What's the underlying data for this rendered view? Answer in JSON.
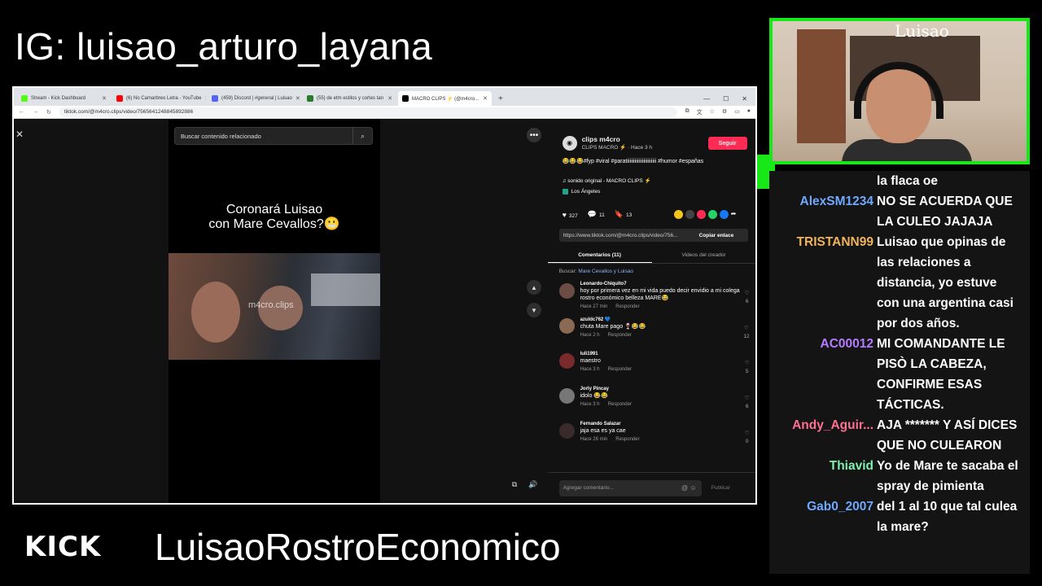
{
  "overlay": {
    "instagram": "IG: luisao_arturo_layana",
    "kick_logo": "KICK",
    "channel": "LuisaoRostroEconomico",
    "accent_color": "#18e818"
  },
  "browser": {
    "tabs": [
      {
        "label": "Stream - Kick Dashboard",
        "favicon_color": "#53fc18"
      },
      {
        "label": "(6) No Camarbreo Letra - YouTube",
        "favicon_color": "#ff0000"
      },
      {
        "label": "(459) Discord | #general | Luisao",
        "favicon_color": "#5865f2"
      },
      {
        "label": "(55) de etm estilos y cortes tan",
        "favicon_color": "#2b7a2b"
      },
      {
        "label": "MACRO CLIPS ⚡ (@m4cro...",
        "favicon_color": "#000000"
      }
    ],
    "new_tab": "+",
    "url": "tiktok.com/@m4cro.clips/video/7565641248845892886"
  },
  "video": {
    "search_placeholder": "Buscar contenido relacionado",
    "caption_line1": "Coronará Luisao",
    "caption_line2": "con Mare Cevallos?😬",
    "watermark": "m4cro.clips"
  },
  "panel": {
    "author_name": "clips m4cro",
    "author_sub": "CLIPS MACRO ⚡ · Hace 3 h",
    "follow_label": "Seguir",
    "description": "😂😂😂#fyp #viral #paratiiiiiiiiiiiiiiiiiiiiiii #humor #españas",
    "music": "♫ sonido original - MACRO CLIPS ⚡",
    "location": "Los Ángeles",
    "likes": "327",
    "comments_count": "11",
    "saves": "13",
    "link": "https://www.tiktok.com/@m4cro.clips/video/756...",
    "copy_label": "Copiar enlace",
    "tab_comments": "Comentarios (11)",
    "tab_creator": "Videos del creador",
    "related_prefix": "Buscar:",
    "related_query": "Mare Cevallos y Luisao",
    "composer_placeholder": "Agregar comentario...",
    "publish_label": "Publicar",
    "comments": [
      {
        "user": "Leonardo-Chiquito7",
        "text": "hoy por primera vez en mi vida puedo decir envidio a mi colega rostro económico belleza MARE😂",
        "time": "Hace 27 min",
        "reply": "Responder",
        "likes": "6"
      },
      {
        "user": "azuldc762 💙",
        "text": "chuta Mare pago 🍷😂😂",
        "time": "Hace 2 h",
        "reply": "Responder",
        "likes": "12"
      },
      {
        "user": "luli1991",
        "text": "maestro",
        "time": "Hace 3 h",
        "reply": "Responder",
        "likes": "5"
      },
      {
        "user": "Jorly Pincay",
        "text": "idolo 😂😂",
        "time": "Hace 3 h",
        "reply": "Responder",
        "likes": "6"
      },
      {
        "user": "Fernando Salazar",
        "text": "jaja esa es ya cae",
        "time": "Hace 26 min",
        "reply": "Responder",
        "likes": "0"
      }
    ]
  },
  "webcam": {
    "logo": "Luisao"
  },
  "chat": [
    {
      "user": "",
      "color": "#ffffff",
      "text": "la flaca oe"
    },
    {
      "user": "AlexSM1234",
      "color": "#6fa8ff",
      "text": "NO SE ACUERDA QUE LA CULEO JAJAJA"
    },
    {
      "user": "TRISTANN99",
      "color": "#f0b35a",
      "text": "Luisao que opinas de las relaciones a distancia, yo estuve con una argentina casi por dos años."
    },
    {
      "user": "AC00012",
      "color": "#b57cff",
      "text": "MI COMANDANTE LE PISÒ LA CABEZA, CONFIRME ESAS TÁCTICAS."
    },
    {
      "user": "Andy_Aguir...",
      "color": "#ff6f91",
      "text": "AJA ******* Y ASÍ DICES QUE NO CULEARON"
    },
    {
      "user": "Thiavid",
      "color": "#7ff0b0",
      "text": "Yo de Mare te sacaba el spray de pimienta"
    },
    {
      "user": "Gab0_2007",
      "color": "#6fa8ff",
      "text": "del 1 al 10 que tal culea la mare?"
    }
  ]
}
